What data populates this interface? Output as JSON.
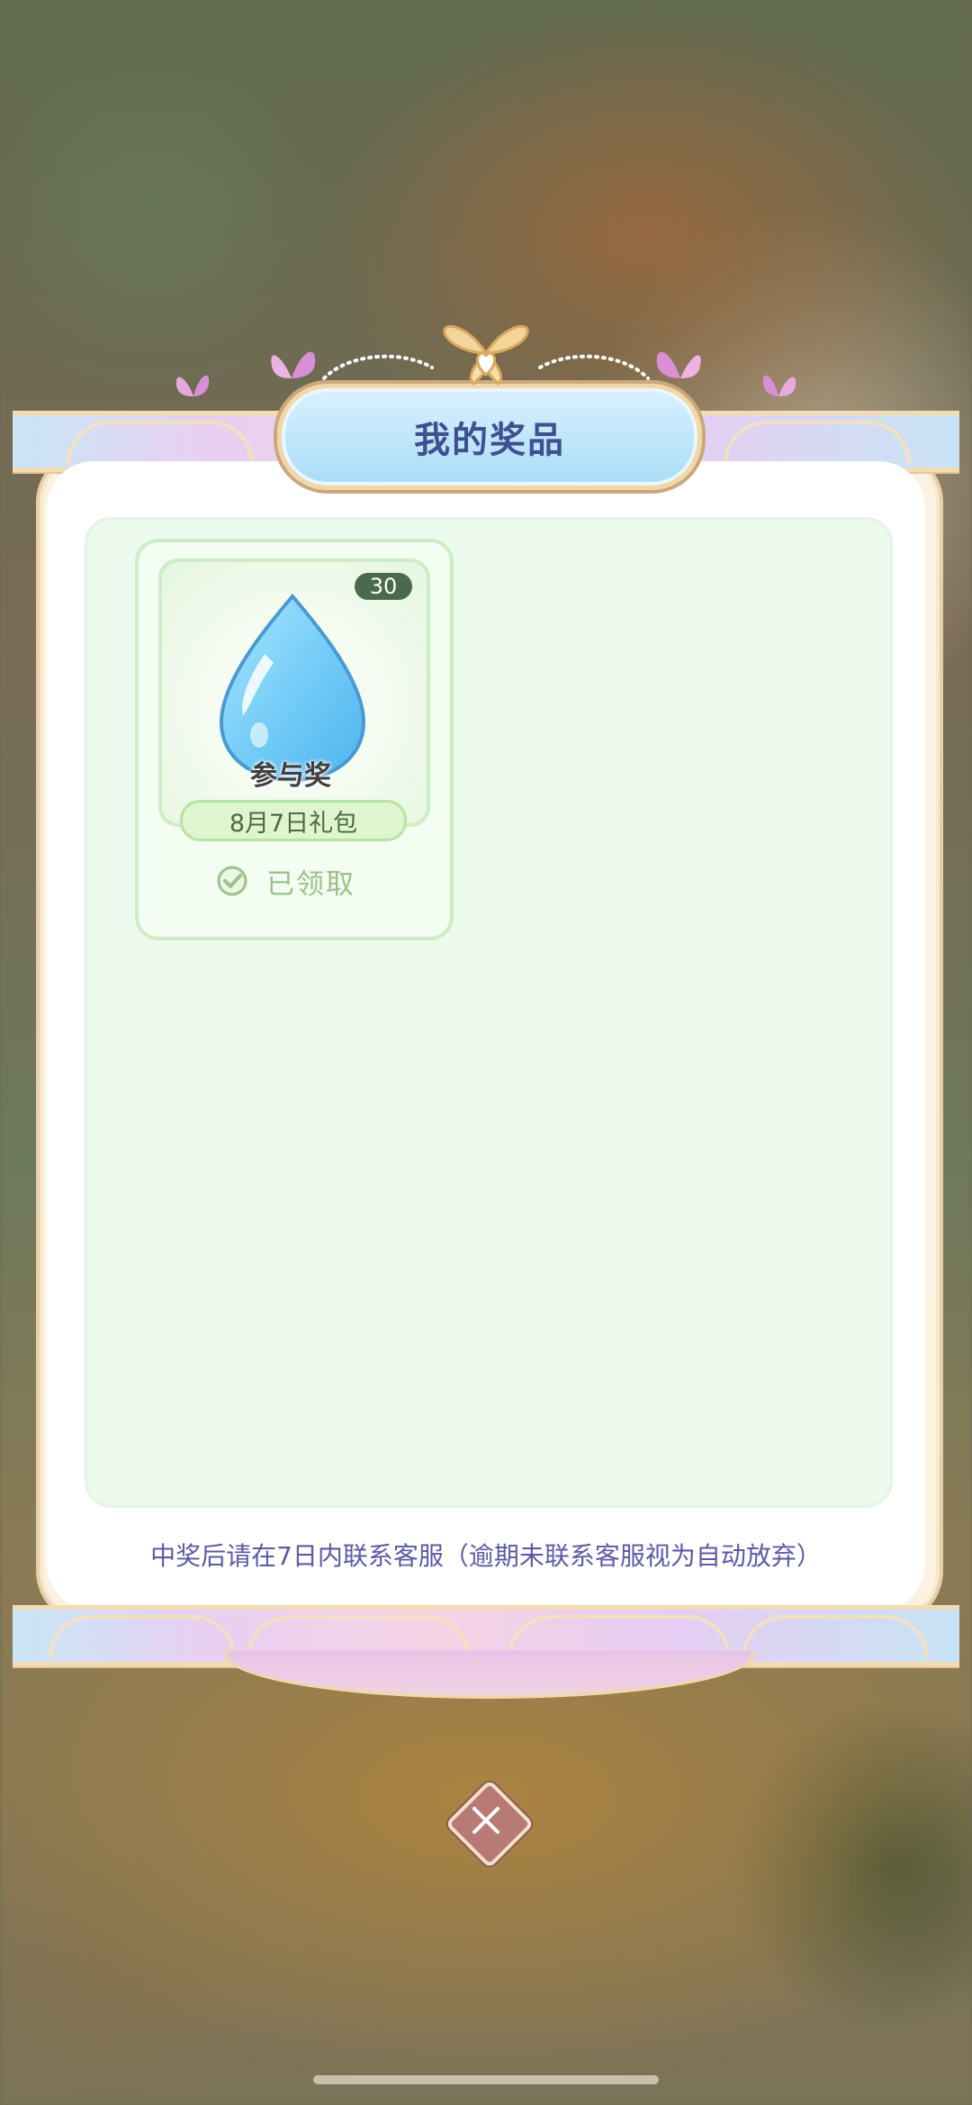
{
  "dialog": {
    "title": "我的奖品"
  },
  "prizes": [
    {
      "name": "参与奖",
      "quantity": "30",
      "gift_label": "8月7日礼包",
      "status": "已领取",
      "icon": "water-drop-icon"
    }
  ],
  "note": "中奖后请在7日内联系客服（逾期未联系客服视为自动放弃）",
  "close": {
    "icon": "close-icon"
  },
  "colors": {
    "title_text": "#3f4f8f",
    "note_text": "#5c5aa6",
    "content_bg": "#ecfbee",
    "claimed_text": "#9cc28a"
  }
}
